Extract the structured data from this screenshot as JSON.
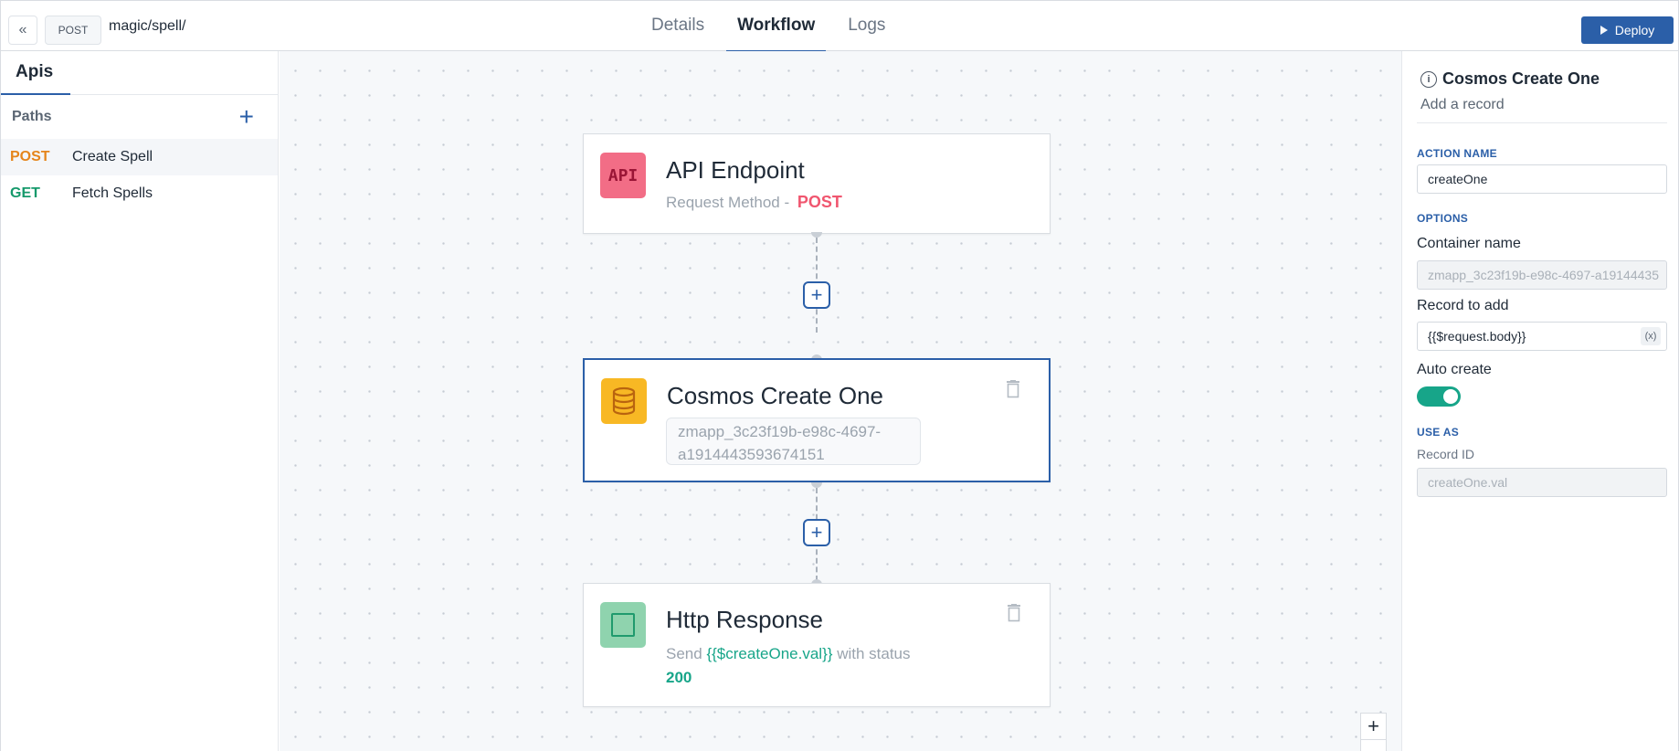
{
  "topbar": {
    "method": "POST",
    "path": "magic/spell/",
    "tabs": [
      {
        "label": "Details"
      },
      {
        "label": "Workflow"
      },
      {
        "label": "Logs"
      }
    ],
    "deploy_label": "Deploy"
  },
  "sidebar": {
    "tab_label": "Apis",
    "paths_label": "Paths",
    "items": [
      {
        "method": "POST",
        "name": "Create Spell"
      },
      {
        "method": "GET",
        "name": "Fetch Spells"
      }
    ]
  },
  "canvas": {
    "api_node": {
      "icon_text": "API",
      "title": "API Endpoint",
      "sub_prefix": "Request Method -",
      "method": "POST"
    },
    "cosmos_node": {
      "title": "Cosmos Create One",
      "container_line1": "zmapp_3c23f19b-e98c-4697-",
      "container_line2": "a1914443593674151"
    },
    "http_node": {
      "title": "Http Response",
      "send_prefix": "Send",
      "send_value": "{{$createOne.val}}",
      "send_suffix": "with status",
      "status": "200"
    },
    "add_symbol": "+",
    "zoom_in": "+",
    "zoom_out": "−"
  },
  "panel": {
    "title": "Cosmos Create One",
    "subtitle": "Add a record",
    "action_name_label": "ACTION NAME",
    "action_name_value": "createOne",
    "options_label": "OPTIONS",
    "container_label": "Container name",
    "container_placeholder": "zmapp_3c23f19b-e98c-4697-a19144435",
    "record_label": "Record to add",
    "record_value": "{{$request.body}}",
    "var_button": "(x)",
    "auto_create_label": "Auto create",
    "auto_create_on": true,
    "use_as_label": "USE AS",
    "record_id_label": "Record ID",
    "record_id_placeholder": "createOne.val"
  },
  "colors": {
    "accent": "#2b5fa8",
    "post": "#e5851b",
    "get": "#15996b",
    "toggle_on": "#17a589",
    "api_icon_bg": "#f26d86",
    "db_icon_bg": "#f8b824",
    "http_icon_bg": "#8fd3ae"
  }
}
